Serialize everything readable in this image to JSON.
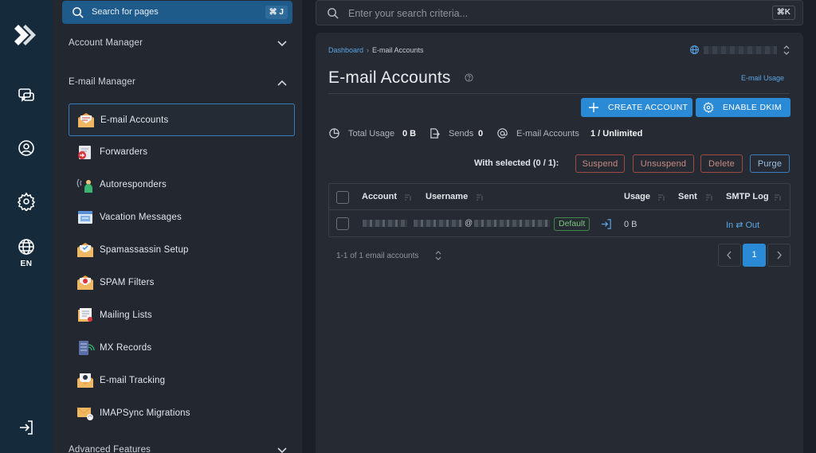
{
  "rail": {
    "language": "EN",
    "icons": [
      "logo-icon",
      "chat-icon",
      "user-icon",
      "gear-icon",
      "globe-icon",
      "logout-icon"
    ]
  },
  "sidebar": {
    "search_placeholder": "Search for pages",
    "search_shortcut": "⌘ J",
    "groups": {
      "account_manager": "Account Manager",
      "email_manager": "E-mail Manager",
      "advanced_features": "Advanced Features"
    },
    "email_items": [
      {
        "label": "E-mail Accounts",
        "icon": "email-accounts-icon",
        "active": true
      },
      {
        "label": "Forwarders",
        "icon": "forwarders-icon"
      },
      {
        "label": "Autoresponders",
        "icon": "autoresponders-icon"
      },
      {
        "label": "Vacation Messages",
        "icon": "vacation-messages-icon"
      },
      {
        "label": "Spamassassin Setup",
        "icon": "spamassassin-icon"
      },
      {
        "label": "SPAM Filters",
        "icon": "spam-filters-icon"
      },
      {
        "label": "Mailing Lists",
        "icon": "mailing-lists-icon"
      },
      {
        "label": "MX Records",
        "icon": "mx-records-icon"
      },
      {
        "label": "E-mail Tracking",
        "icon": "email-tracking-icon"
      },
      {
        "label": "IMAPSync Migrations",
        "icon": "imapsync-icon"
      }
    ]
  },
  "topsearch": {
    "placeholder": "Enter your search criteria...",
    "shortcut": "⌘K"
  },
  "main": {
    "breadcrumb": {
      "root": "Dashboard",
      "current": "E-mail Accounts"
    },
    "title": "E-mail Accounts",
    "usage_link": "E-mail Usage",
    "buttons": {
      "create": "CREATE ACCOUNT",
      "dkim": "ENABLE DKIM"
    },
    "stats": {
      "total_usage_label": "Total Usage",
      "total_usage_value": "0 B",
      "sends_label": "Sends",
      "sends_value": "0",
      "accounts_label": "E-mail Accounts",
      "accounts_value": "1 / Unlimited"
    },
    "bulk": {
      "with_selected": "With selected (0 / 1):",
      "suspend": "Suspend",
      "unsuspend": "Unsuspend",
      "delete": "Delete",
      "purge": "Purge"
    },
    "table": {
      "headers": {
        "account": "Account",
        "username": "Username",
        "usage": "Usage",
        "sent": "Sent",
        "smtp_log": "SMTP Log"
      },
      "rows": [
        {
          "at": "@",
          "badge": "Default",
          "usage": "0 B",
          "smtp": "In ⇄ Out"
        }
      ]
    },
    "footer": {
      "count": "1-1 of 1 email accounts",
      "page": "1"
    }
  },
  "colors": {
    "accent": "#2b8ad6",
    "rail": "#152a3b",
    "sidebar": "#232830",
    "panel": "#262b33"
  }
}
